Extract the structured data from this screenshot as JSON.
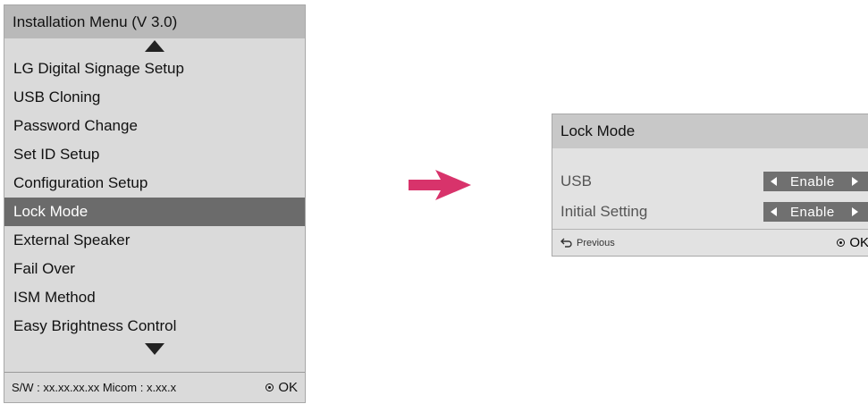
{
  "installation_menu": {
    "title": "Installation Menu (V 3.0)",
    "items": [
      {
        "label": "LG Digital Signage Setup",
        "selected": false
      },
      {
        "label": "USB Cloning",
        "selected": false
      },
      {
        "label": "Password Change",
        "selected": false
      },
      {
        "label": "Set ID Setup",
        "selected": false
      },
      {
        "label": "Configuration Setup",
        "selected": false
      },
      {
        "label": "Lock Mode",
        "selected": true
      },
      {
        "label": "External Speaker",
        "selected": false
      },
      {
        "label": "Fail Over",
        "selected": false
      },
      {
        "label": "ISM Method",
        "selected": false
      },
      {
        "label": "Easy Brightness Control",
        "selected": false
      }
    ],
    "footer_info": "S/W : xx.xx.xx.xx Micom : x.xx.x",
    "ok_label": "OK",
    "scroll_up_icon": "triangle-up-icon",
    "scroll_down_icon": "triangle-down-icon"
  },
  "transition_arrow": {
    "icon": "right-arrow-icon",
    "color": "#d8336b"
  },
  "lock_mode_dialog": {
    "title": "Lock Mode",
    "settings": [
      {
        "label": "USB",
        "value": "Enable"
      },
      {
        "label": "Initial Setting",
        "value": "Enable"
      }
    ],
    "previous_label": "Previous",
    "ok_label": "OK"
  },
  "colors": {
    "panel_bg": "#dadada",
    "title_bg": "#b9b9b9",
    "selected_bg": "#6b6b6b",
    "spinner_bg": "#707070",
    "arrow_accent": "#d8336b"
  }
}
